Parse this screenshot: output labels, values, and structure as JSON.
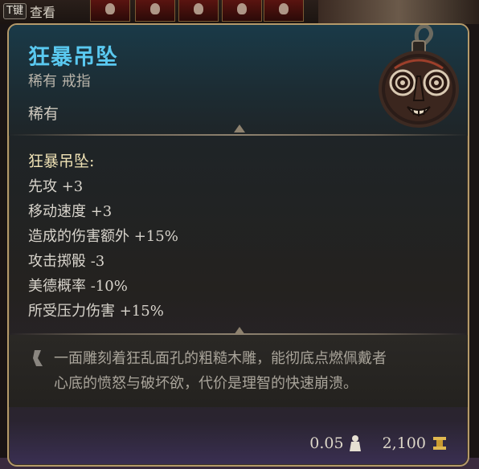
{
  "hud": {
    "key_label": "T键",
    "key_action": "查看"
  },
  "item": {
    "name": "狂暴吊坠",
    "rarity_type": "稀有 戒指",
    "rarity": "稀有",
    "effect_title": "狂暴吊坠:",
    "effects": [
      "先攻 +3",
      "移动速度 +3",
      "造成的伤害额外 +15%",
      "攻击掷骰 -3",
      "美德概率 -10%",
      "所受压力伤害 +15%"
    ],
    "description_lines": [
      "一面雕刻着狂乱面孔的粗糙木雕，能彻底点燃佩戴者",
      "心底的愤怒与破坏欲，代价是理智的快速崩溃。"
    ],
    "weight": "0.05",
    "price": "2,100"
  },
  "colors": {
    "title": "#5ac9f0",
    "border": "#b59a6a",
    "effect_title": "#efe2b5"
  },
  "icons": [
    "pendant-mask-icon",
    "quote-mark-icon",
    "weight-icon",
    "gold-coin-icon"
  ]
}
